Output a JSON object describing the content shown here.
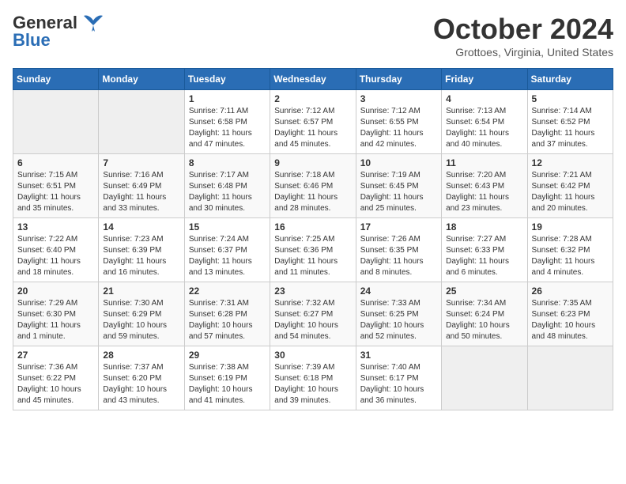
{
  "header": {
    "logo_line1": "General",
    "logo_line2": "Blue",
    "month": "October 2024",
    "location": "Grottoes, Virginia, United States"
  },
  "days_of_week": [
    "Sunday",
    "Monday",
    "Tuesday",
    "Wednesday",
    "Thursday",
    "Friday",
    "Saturday"
  ],
  "weeks": [
    [
      {
        "day": "",
        "empty": true
      },
      {
        "day": "",
        "empty": true
      },
      {
        "day": "1",
        "sunrise": "7:11 AM",
        "sunset": "6:58 PM",
        "daylight": "11 hours and 47 minutes."
      },
      {
        "day": "2",
        "sunrise": "7:12 AM",
        "sunset": "6:57 PM",
        "daylight": "11 hours and 45 minutes."
      },
      {
        "day": "3",
        "sunrise": "7:12 AM",
        "sunset": "6:55 PM",
        "daylight": "11 hours and 42 minutes."
      },
      {
        "day": "4",
        "sunrise": "7:13 AM",
        "sunset": "6:54 PM",
        "daylight": "11 hours and 40 minutes."
      },
      {
        "day": "5",
        "sunrise": "7:14 AM",
        "sunset": "6:52 PM",
        "daylight": "11 hours and 37 minutes."
      }
    ],
    [
      {
        "day": "6",
        "sunrise": "7:15 AM",
        "sunset": "6:51 PM",
        "daylight": "11 hours and 35 minutes."
      },
      {
        "day": "7",
        "sunrise": "7:16 AM",
        "sunset": "6:49 PM",
        "daylight": "11 hours and 33 minutes."
      },
      {
        "day": "8",
        "sunrise": "7:17 AM",
        "sunset": "6:48 PM",
        "daylight": "11 hours and 30 minutes."
      },
      {
        "day": "9",
        "sunrise": "7:18 AM",
        "sunset": "6:46 PM",
        "daylight": "11 hours and 28 minutes."
      },
      {
        "day": "10",
        "sunrise": "7:19 AM",
        "sunset": "6:45 PM",
        "daylight": "11 hours and 25 minutes."
      },
      {
        "day": "11",
        "sunrise": "7:20 AM",
        "sunset": "6:43 PM",
        "daylight": "11 hours and 23 minutes."
      },
      {
        "day": "12",
        "sunrise": "7:21 AM",
        "sunset": "6:42 PM",
        "daylight": "11 hours and 20 minutes."
      }
    ],
    [
      {
        "day": "13",
        "sunrise": "7:22 AM",
        "sunset": "6:40 PM",
        "daylight": "11 hours and 18 minutes."
      },
      {
        "day": "14",
        "sunrise": "7:23 AM",
        "sunset": "6:39 PM",
        "daylight": "11 hours and 16 minutes."
      },
      {
        "day": "15",
        "sunrise": "7:24 AM",
        "sunset": "6:37 PM",
        "daylight": "11 hours and 13 minutes."
      },
      {
        "day": "16",
        "sunrise": "7:25 AM",
        "sunset": "6:36 PM",
        "daylight": "11 hours and 11 minutes."
      },
      {
        "day": "17",
        "sunrise": "7:26 AM",
        "sunset": "6:35 PM",
        "daylight": "11 hours and 8 minutes."
      },
      {
        "day": "18",
        "sunrise": "7:27 AM",
        "sunset": "6:33 PM",
        "daylight": "11 hours and 6 minutes."
      },
      {
        "day": "19",
        "sunrise": "7:28 AM",
        "sunset": "6:32 PM",
        "daylight": "11 hours and 4 minutes."
      }
    ],
    [
      {
        "day": "20",
        "sunrise": "7:29 AM",
        "sunset": "6:30 PM",
        "daylight": "11 hours and 1 minute."
      },
      {
        "day": "21",
        "sunrise": "7:30 AM",
        "sunset": "6:29 PM",
        "daylight": "10 hours and 59 minutes."
      },
      {
        "day": "22",
        "sunrise": "7:31 AM",
        "sunset": "6:28 PM",
        "daylight": "10 hours and 57 minutes."
      },
      {
        "day": "23",
        "sunrise": "7:32 AM",
        "sunset": "6:27 PM",
        "daylight": "10 hours and 54 minutes."
      },
      {
        "day": "24",
        "sunrise": "7:33 AM",
        "sunset": "6:25 PM",
        "daylight": "10 hours and 52 minutes."
      },
      {
        "day": "25",
        "sunrise": "7:34 AM",
        "sunset": "6:24 PM",
        "daylight": "10 hours and 50 minutes."
      },
      {
        "day": "26",
        "sunrise": "7:35 AM",
        "sunset": "6:23 PM",
        "daylight": "10 hours and 48 minutes."
      }
    ],
    [
      {
        "day": "27",
        "sunrise": "7:36 AM",
        "sunset": "6:22 PM",
        "daylight": "10 hours and 45 minutes."
      },
      {
        "day": "28",
        "sunrise": "7:37 AM",
        "sunset": "6:20 PM",
        "daylight": "10 hours and 43 minutes."
      },
      {
        "day": "29",
        "sunrise": "7:38 AM",
        "sunset": "6:19 PM",
        "daylight": "10 hours and 41 minutes."
      },
      {
        "day": "30",
        "sunrise": "7:39 AM",
        "sunset": "6:18 PM",
        "daylight": "10 hours and 39 minutes."
      },
      {
        "day": "31",
        "sunrise": "7:40 AM",
        "sunset": "6:17 PM",
        "daylight": "10 hours and 36 minutes."
      },
      {
        "day": "",
        "empty": true
      },
      {
        "day": "",
        "empty": true
      }
    ]
  ]
}
